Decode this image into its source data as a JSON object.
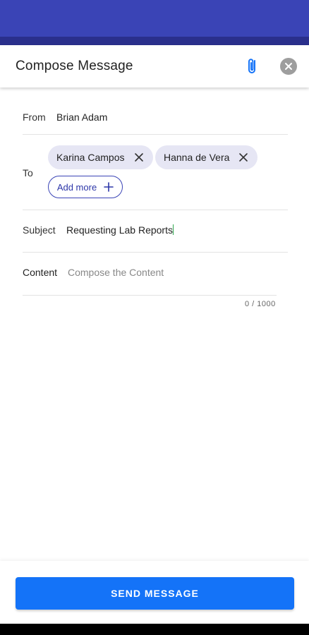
{
  "header": {
    "title": "Compose Message",
    "attach_icon": "paperclip-icon",
    "close_icon": "close-icon"
  },
  "form": {
    "from": {
      "label": "From",
      "value": "Brian Adam"
    },
    "to": {
      "label": "To",
      "recipients": [
        "Karina Campos",
        "Hanna de Vera"
      ],
      "add_more_label": "Add more"
    },
    "subject": {
      "label": "Subject",
      "value": "Requesting Lab Reports"
    },
    "content": {
      "label": "Content",
      "placeholder": "Compose the Content",
      "value": "",
      "counter": "0 / 1000"
    }
  },
  "actions": {
    "send_label": "SEND MESSAGE"
  },
  "colors": {
    "status_bar": "#3a44b6",
    "primary_button": "#1473f8",
    "chip_bg": "#e6e6f4",
    "accent": "#2c36a8"
  }
}
